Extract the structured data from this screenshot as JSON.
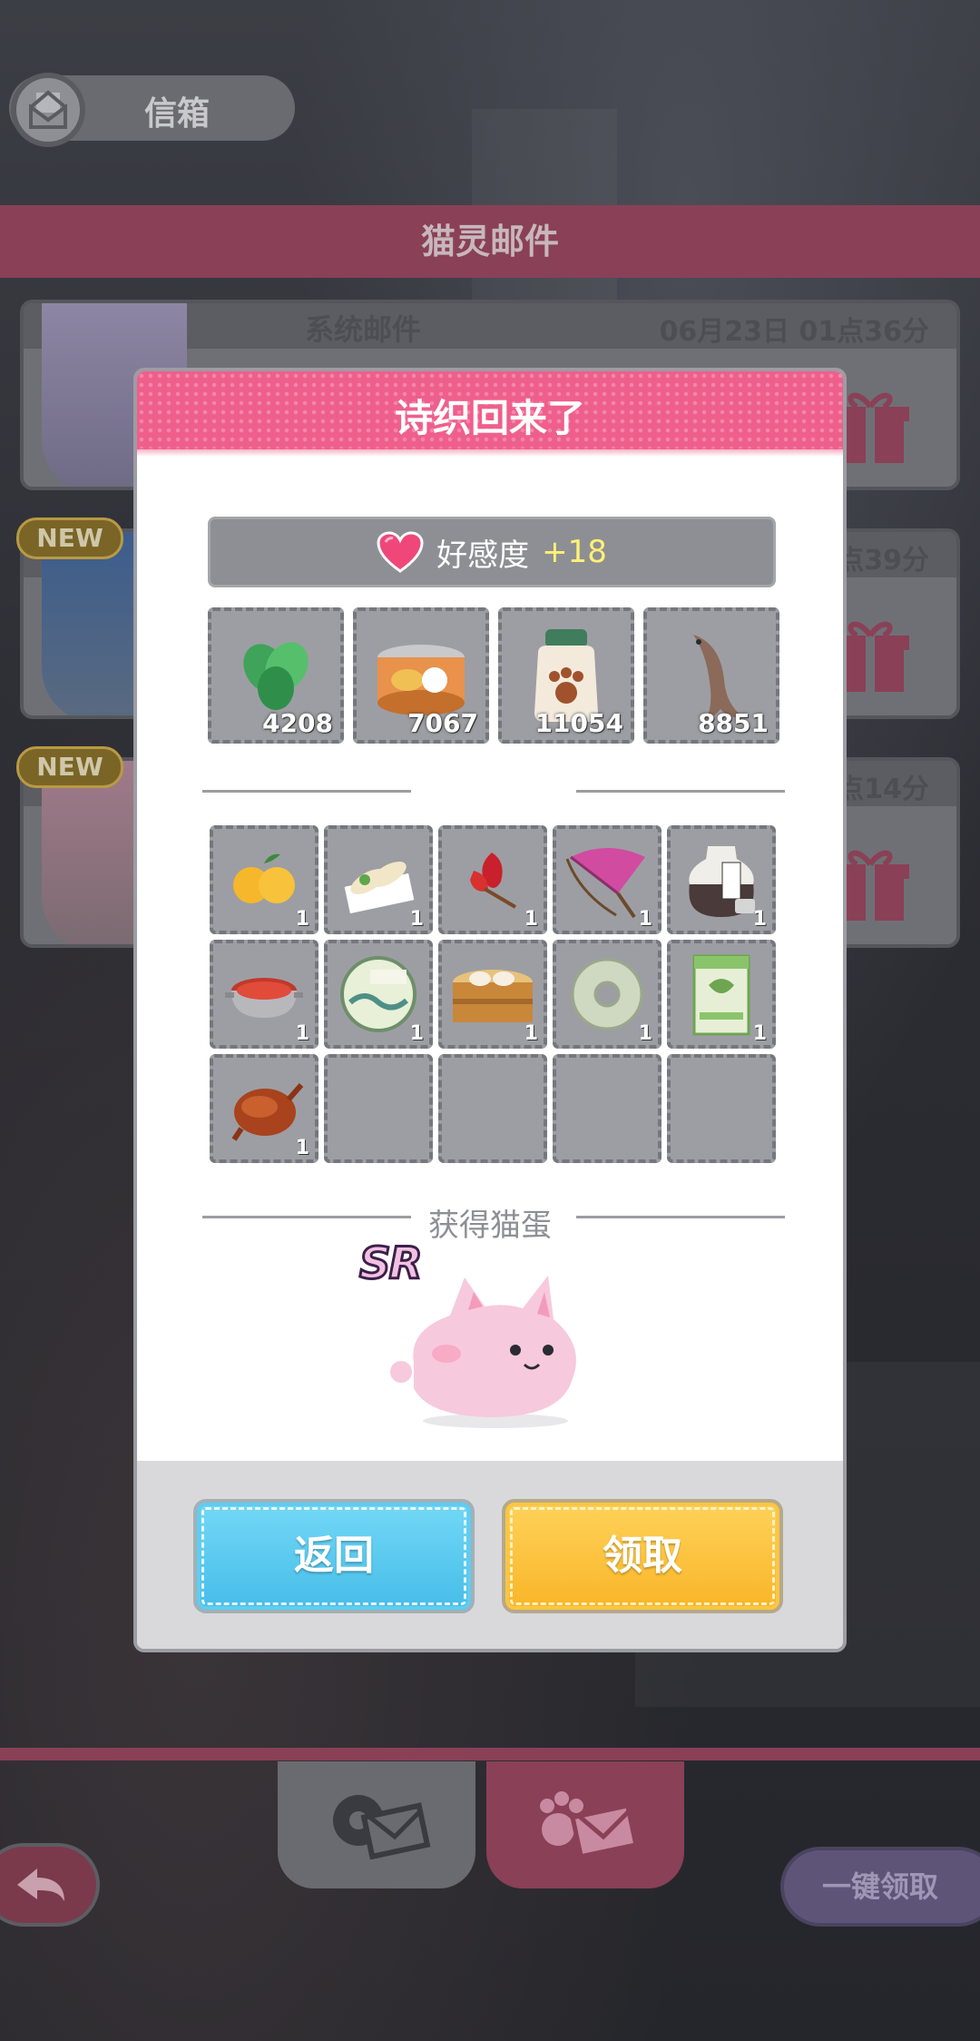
{
  "mailbox": {
    "title": "信箱",
    "section_title": "猫灵邮件"
  },
  "mail_list": [
    {
      "type": "系统邮件",
      "time": "06月23日 01点36分",
      "is_new": false
    },
    {
      "type": "",
      "time": "点39分",
      "is_new": true,
      "badge": "NEW"
    },
    {
      "type": "",
      "time": "点14分",
      "is_new": true,
      "badge": "NEW"
    }
  ],
  "bottom": {
    "claim_all_label": "一键领取"
  },
  "dialog": {
    "title": "诗织回来了",
    "affinity_label": "好感度",
    "affinity_value": "+18",
    "main_items": [
      {
        "icon": "mint-leaves-icon",
        "count": "4208"
      },
      {
        "icon": "fish-can-icon",
        "count": "7067"
      },
      {
        "icon": "paw-jar-icon",
        "count": "11054"
      },
      {
        "icon": "dried-fish-icon",
        "count": "8851"
      }
    ],
    "gift_items": [
      {
        "icon": "oranges-icon",
        "count": "1"
      },
      {
        "icon": "spring-rolls-icon",
        "count": "1"
      },
      {
        "icon": "red-flower-icon",
        "count": "1"
      },
      {
        "icon": "paper-umbrella-icon",
        "count": "1"
      },
      {
        "icon": "liquor-jar-icon",
        "count": "1"
      },
      {
        "icon": "hotpot-icon",
        "count": "1"
      },
      {
        "icon": "puer-tea-cake-icon",
        "count": "1"
      },
      {
        "icon": "dumpling-steamer-icon",
        "count": "1"
      },
      {
        "icon": "jade-disc-icon",
        "count": "1"
      },
      {
        "icon": "tea-bag-icon",
        "count": "1"
      },
      {
        "icon": "roast-duck-icon",
        "count": "1"
      },
      {
        "icon": "",
        "count": ""
      },
      {
        "icon": "",
        "count": ""
      },
      {
        "icon": "",
        "count": ""
      },
      {
        "icon": "",
        "count": ""
      }
    ],
    "egg_section_label": "获得猫蛋",
    "egg_rarity": "SR",
    "return_label": "返回",
    "claim_label": "领取"
  },
  "colors": {
    "dialog_header": "#ef5f8c",
    "return_button": "#4cc3ec",
    "claim_button": "#fbbd33",
    "affinity_value": "#fff176"
  }
}
